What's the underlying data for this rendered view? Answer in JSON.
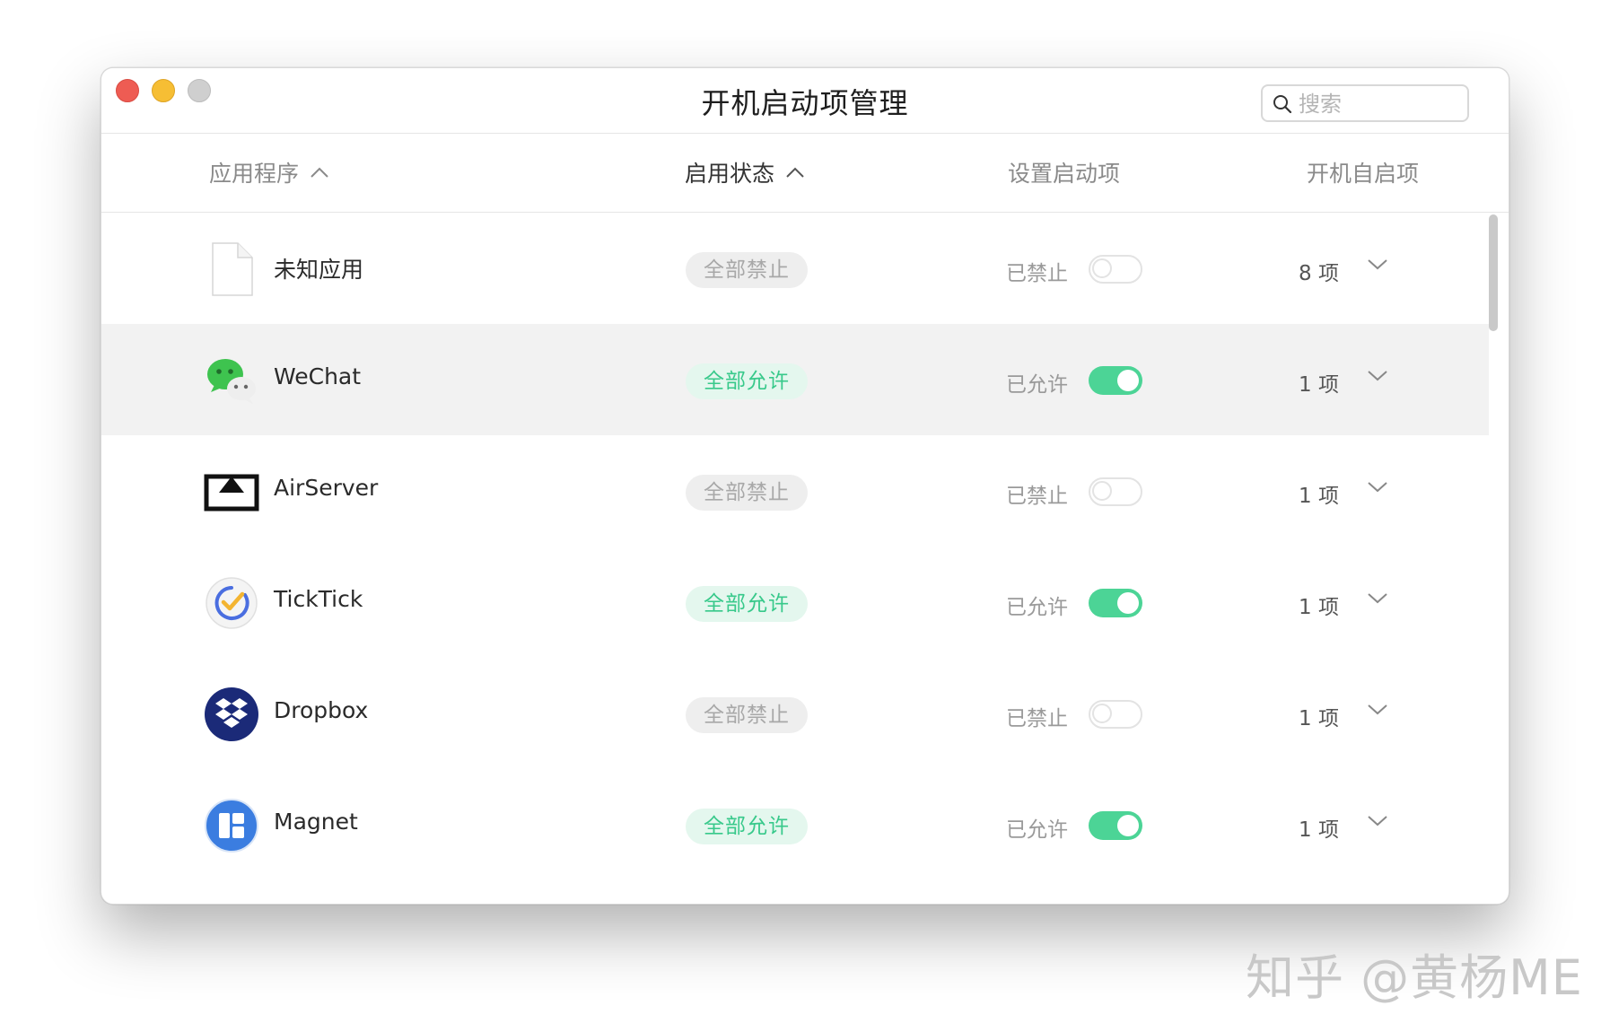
{
  "window": {
    "title": "开机启动项管理"
  },
  "search": {
    "placeholder": "搜索"
  },
  "columns": {
    "app": "应用程序",
    "status": "启用状态",
    "setting": "设置启动项",
    "boot": "开机自启项"
  },
  "rows": [
    {
      "name": "未知应用",
      "icon": "document-icon",
      "status": "全部禁止",
      "enabled": false,
      "state_label": "已禁止",
      "count": "8 项"
    },
    {
      "name": "WeChat",
      "icon": "wechat-icon",
      "status": "全部允许",
      "enabled": true,
      "state_label": "已允许",
      "count": "1 项"
    },
    {
      "name": "AirServer",
      "icon": "airserver-icon",
      "status": "全部禁止",
      "enabled": false,
      "state_label": "已禁止",
      "count": "1 项"
    },
    {
      "name": "TickTick",
      "icon": "ticktick-icon",
      "status": "全部允许",
      "enabled": true,
      "state_label": "已允许",
      "count": "1 项"
    },
    {
      "name": "Dropbox",
      "icon": "dropbox-icon",
      "status": "全部禁止",
      "enabled": false,
      "state_label": "已禁止",
      "count": "1 项"
    },
    {
      "name": "Magnet",
      "icon": "magnet-icon",
      "status": "全部允许",
      "enabled": true,
      "state_label": "已允许",
      "count": "1 项"
    }
  ],
  "watermark": "知乎 @黄杨ME",
  "colors": {
    "accent_green": "#4cd496",
    "close": "#ee5c53",
    "minimize": "#f6be34",
    "zoom": "#cfcfcf"
  }
}
